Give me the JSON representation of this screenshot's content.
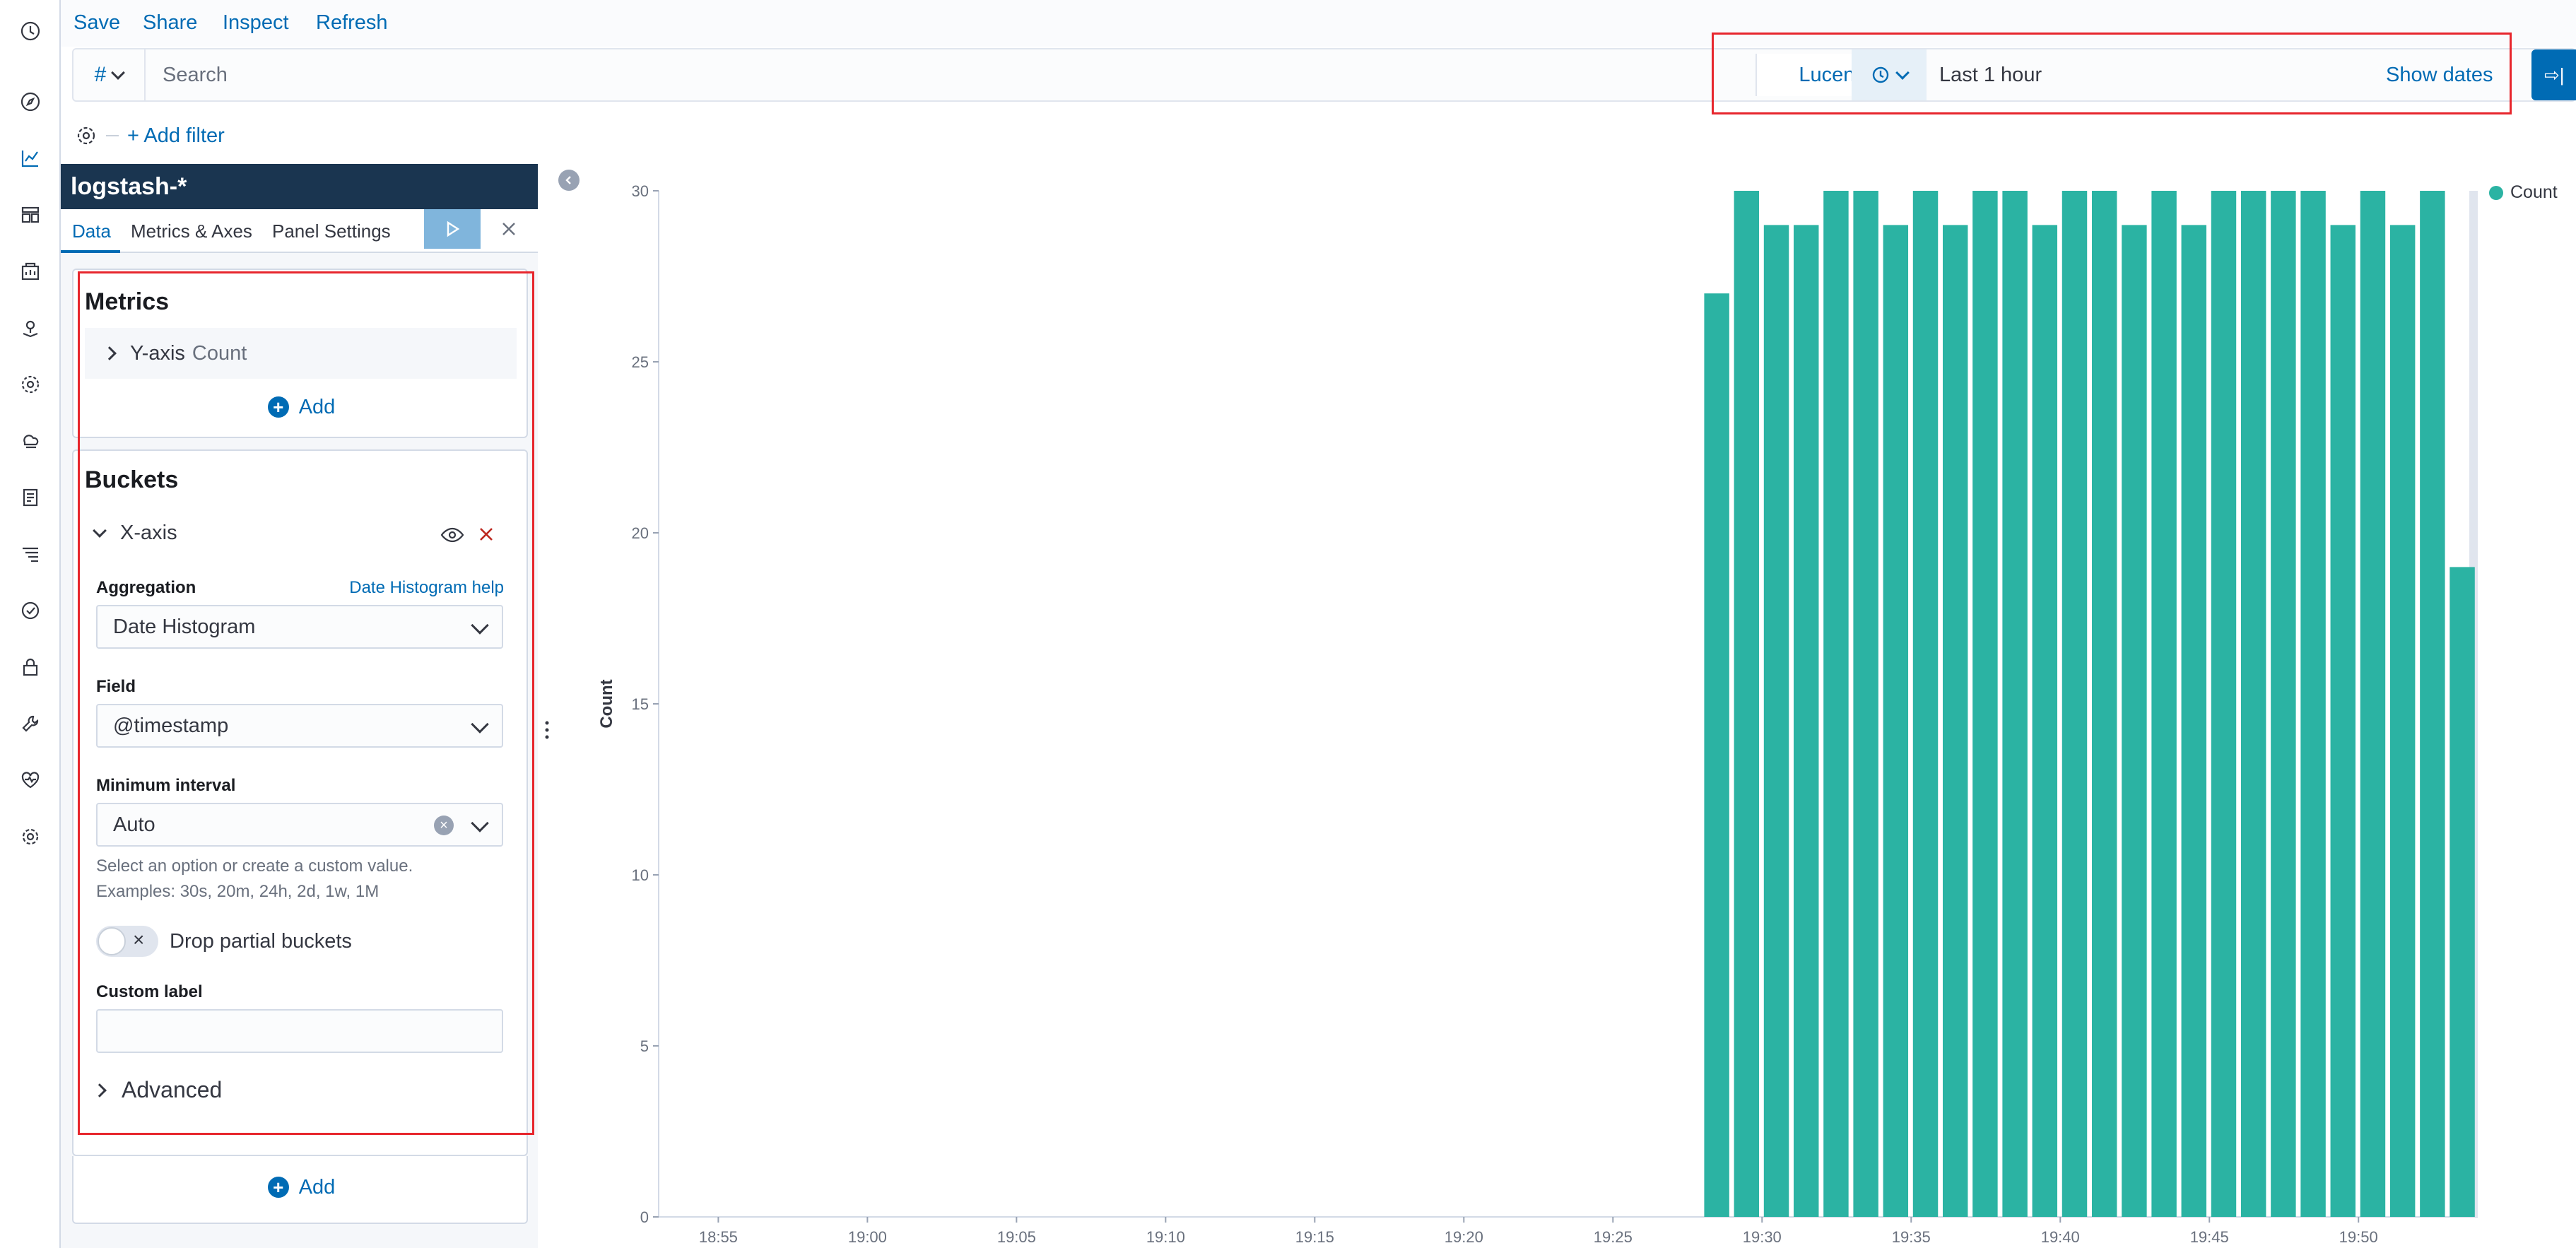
{
  "top_menu": {
    "save": "Save",
    "share": "Share",
    "inspect": "Inspect",
    "refresh": "Refresh"
  },
  "query_bar": {
    "lang_symbol": "#",
    "search_placeholder": "Search",
    "query_language": "Lucene",
    "time_range": "Last 1 hour",
    "show_dates": "Show dates"
  },
  "filter_bar": {
    "add_filter": "+ Add filter"
  },
  "editor": {
    "index_pattern": "logstash-*",
    "tabs": [
      "Data",
      "Metrics & Axes",
      "Panel Settings"
    ],
    "metrics": {
      "title": "Metrics",
      "y_axis_label": "Y-axis",
      "y_axis_agg": "Count",
      "add_label": "Add"
    },
    "buckets": {
      "title": "Buckets",
      "x_axis_label": "X-axis",
      "aggregation_label": "Aggregation",
      "aggregation_help": "Date Histogram help",
      "aggregation_value": "Date Histogram",
      "field_label": "Field",
      "field_value": "@timestamp",
      "interval_label": "Minimum interval",
      "interval_value": "Auto",
      "interval_help_1": "Select an option or create a custom value.",
      "interval_help_2": "Examples: 30s, 20m, 24h, 2d, 1w, 1M",
      "drop_partial_label": "Drop partial buckets",
      "drop_partial_enabled": false,
      "custom_label_label": "Custom label",
      "custom_label_value": "",
      "advanced_label": "Advanced",
      "add_label": "Add"
    }
  },
  "colors": {
    "accent": "#006bb4",
    "bar": "#2bb3a3",
    "header": "#1a3550",
    "highlight": "#e7262d"
  },
  "chart_data": {
    "type": "bar",
    "ylabel": "Count",
    "ylim": [
      0,
      30
    ],
    "yticks": [
      0,
      5,
      10,
      15,
      20,
      25,
      30
    ],
    "x_tick_labels": [
      "18:55",
      "19:00",
      "19:05",
      "19:10",
      "19:15",
      "19:20",
      "19:25",
      "19:30",
      "19:35",
      "19:40",
      "19:45",
      "19:50"
    ],
    "legend": [
      {
        "name": "Count",
        "color": "#2bb3a3"
      }
    ],
    "bars": [
      {
        "x": "19:28",
        "value": 27
      },
      {
        "x": "19:29",
        "value": 30
      },
      {
        "x": "19:30",
        "value": 29
      },
      {
        "x": "19:31",
        "value": 29
      },
      {
        "x": "19:32",
        "value": 30
      },
      {
        "x": "19:33",
        "value": 30
      },
      {
        "x": "19:34",
        "value": 29
      },
      {
        "x": "19:35",
        "value": 30
      },
      {
        "x": "19:36",
        "value": 29
      },
      {
        "x": "19:37",
        "value": 30
      },
      {
        "x": "19:38",
        "value": 30
      },
      {
        "x": "19:39",
        "value": 29
      },
      {
        "x": "19:40",
        "value": 30
      },
      {
        "x": "19:41",
        "value": 30
      },
      {
        "x": "19:42",
        "value": 29
      },
      {
        "x": "19:43",
        "value": 30
      },
      {
        "x": "19:44",
        "value": 29
      },
      {
        "x": "19:45",
        "value": 30
      },
      {
        "x": "19:46",
        "value": 30
      },
      {
        "x": "19:47",
        "value": 30
      },
      {
        "x": "19:48",
        "value": 30
      },
      {
        "x": "19:49",
        "value": 29
      },
      {
        "x": "19:50",
        "value": 30
      },
      {
        "x": "19:51",
        "value": 29
      },
      {
        "x": "19:52",
        "value": 30
      },
      {
        "x": "19:53",
        "value": 19
      }
    ]
  }
}
